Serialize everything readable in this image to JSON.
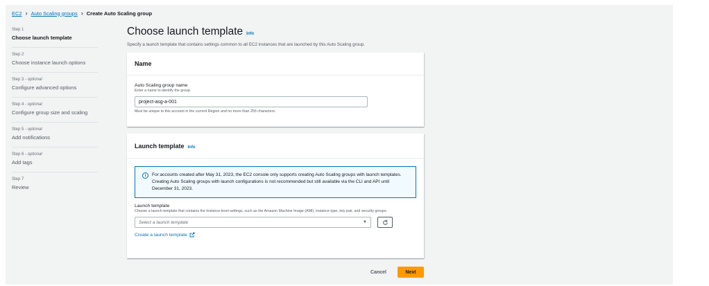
{
  "breadcrumb": {
    "items": [
      "EC2",
      "Auto Scaling groups"
    ],
    "current": "Create Auto Scaling group"
  },
  "steps": [
    {
      "num": "Step 1",
      "optional": "",
      "title": "Choose launch template",
      "active": true
    },
    {
      "num": "Step 2",
      "optional": "",
      "title": "Choose instance launch options",
      "active": false
    },
    {
      "num": "Step 3",
      "optional": "optional",
      "title": "Configure advanced options",
      "active": false
    },
    {
      "num": "Step 4",
      "optional": "optional",
      "title": "Configure group size and scaling",
      "active": false
    },
    {
      "num": "Step 5",
      "optional": "optional",
      "title": "Add notifications",
      "active": false
    },
    {
      "num": "Step 6",
      "optional": "optional",
      "title": "Add tags",
      "active": false
    },
    {
      "num": "Step 7",
      "optional": "",
      "title": "Review",
      "active": false
    }
  ],
  "header": {
    "title": "Choose launch template",
    "info": "Info",
    "description": "Specify a launch template that contains settings common to all EC2 instances that are launched by this Auto Scaling group."
  },
  "name_section": {
    "title": "Name",
    "field_label": "Auto Scaling group name",
    "field_desc": "Enter a name to identify the group.",
    "value": "project-asg-a-001",
    "constraint": "Must be unique to this account in the current Region and no more than 255 characters."
  },
  "launch_section": {
    "title": "Launch template",
    "info": "Info",
    "alert": "For accounts created after May 31, 2023, the EC2 console only supports creating Auto Scaling groups with launch templates. Creating Auto Scaling groups with launch configurations is not recommended but still available via the CLI and API until December 31, 2023.",
    "field_label": "Launch template",
    "field_desc": "Choose a launch template that contains the instance-level settings, such as the Amazon Machine Image (AMI), instance type, key pair, and security groups.",
    "select_placeholder": "Select a launch template",
    "create_link": "Create a launch template"
  },
  "footer": {
    "cancel": "Cancel",
    "next": "Next"
  },
  "colors": {
    "link": "#0073bb",
    "primary": "#ff9900",
    "background": "#f2f3f3"
  },
  "icons": [
    "chevron-right-icon",
    "info-circle-icon",
    "caret-down-icon",
    "refresh-icon",
    "external-link-icon"
  ]
}
